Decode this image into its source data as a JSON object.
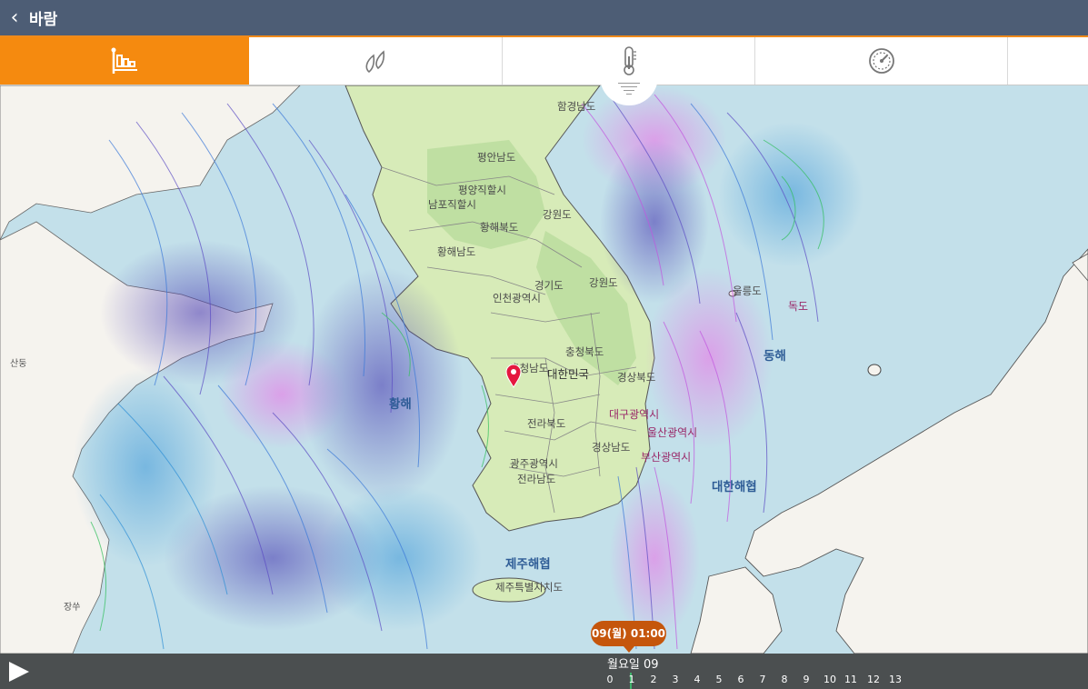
{
  "header": {
    "title": "바람",
    "back_icon": "chevron-left-icon"
  },
  "tabs": [
    {
      "name": "wind",
      "icon": "wind-flag-icon",
      "active": true
    },
    {
      "name": "precipitation",
      "icon": "raindrops-icon",
      "active": false
    },
    {
      "name": "temperature",
      "icon": "thermometer-icon",
      "active": false
    },
    {
      "name": "pressure",
      "icon": "gauge-icon",
      "active": false
    }
  ],
  "colors": {
    "header_bg": "#4d5d75",
    "accent": "#f58a0f",
    "sea": "#c3e0ea",
    "land": "#f5f3ee",
    "bubble": "#c5560c"
  },
  "map": {
    "regions": {
      "hamgyeongnamdo": "함경남도",
      "pyeongannamdo": "평안남도",
      "pyeongyang": "평양직할시",
      "nampo": "남포직할시",
      "hwanghaebukdo": "황해북도",
      "gangwondo_n": "강원도",
      "hwanghaenamdo": "황해남도",
      "gyeonggido": "경기도",
      "gangwondo_s": "강원도",
      "incheon": "인천광역시",
      "chungcheongbukdo": "충청북도",
      "chungcheongnamdo": "충청남도",
      "south_korea": "대한민국",
      "gyeongsangbukdo": "경상북도",
      "daegu": "대구광역시",
      "jeollabukdo": "전라북도",
      "ulsan": "울산광역시",
      "gyeongsangnamdo": "경상남도",
      "busan": "부산광역시",
      "gwangju": "광주광역시",
      "jeollanamdo": "전라남도",
      "jeju_strait": "제주해협",
      "jeju": "제주특별자치도",
      "ulleungdo": "울릉도",
      "dokdo": "독도",
      "east_sea": "동해",
      "yellow_sea": "황해",
      "korea_strait": "대한해협",
      "shandong": "산둥",
      "jiangsu": "장쑤"
    }
  },
  "timeline": {
    "time_bubble": "09(월) 01:00",
    "day_label": "월요일 09",
    "hours": [
      "0",
      "1",
      "2",
      "3",
      "4",
      "5",
      "6",
      "7",
      "8",
      "9",
      "10",
      "11",
      "12",
      "13"
    ],
    "play_icon": "play-icon"
  }
}
